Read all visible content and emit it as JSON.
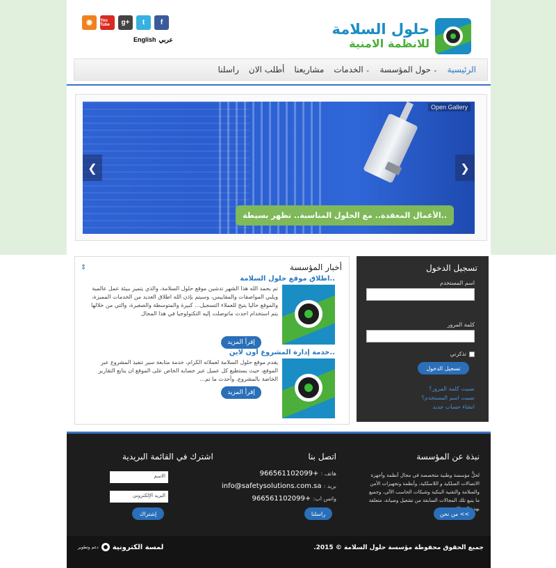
{
  "header": {
    "logo_line1": "حلول السلامة",
    "logo_line2": "للانظمة الامنية",
    "socials": [
      {
        "name": "rss-icon",
        "glyph": "◉"
      },
      {
        "name": "youtube-icon",
        "glyph": "You Tube"
      },
      {
        "name": "google-plus-icon",
        "glyph": "g+"
      },
      {
        "name": "twitter-icon",
        "glyph": "t"
      },
      {
        "name": "facebook-icon",
        "glyph": "f"
      }
    ],
    "lang_arabic": "عربي",
    "lang_english": "English"
  },
  "nav": {
    "items": [
      {
        "label": "الرئيسية",
        "active": true,
        "dropdown": false
      },
      {
        "label": "حول المؤسسة",
        "active": false,
        "dropdown": true
      },
      {
        "label": "الخدمات",
        "active": false,
        "dropdown": true
      },
      {
        "label": "مشاريعنا",
        "active": false,
        "dropdown": false
      },
      {
        "label": "أطلب الان",
        "active": false,
        "dropdown": false
      },
      {
        "label": "راسلنا",
        "active": false,
        "dropdown": false
      }
    ],
    "chevron": "⌄"
  },
  "slider": {
    "open_gallery": "Open Gallery",
    "caption": "الأعمال المعقدة.. مع الحلول المناسبة.. تظهر بسيطة..",
    "prev": "❮",
    "next": "❯"
  },
  "news": {
    "title": "أخبار المؤسسة",
    "scroll_glyph": "⇕",
    "items": [
      {
        "title": "اطلاق موقع حلول السلامة..",
        "body": "تم بحمد الله هذا الشهر تدشين موقع حلول السلامة، والذي يتميز ببيئة عمل عالمية ويلبي المواصفات والمقاييس، وسيتم بإذن الله اطلاق العديد من الخدمات المميزة، والموقع حاليا يتيح للعملاء التسجيل... كبيرة والمتوسطة والصغيرة، والتي من خلالها يتم استخدام احدث ماتوصلت إليه التكنولوجيا في هذا المجال",
        "more": "إقرأ المزيد"
      },
      {
        "title": "خدمة إدارة المشروع أون لاين..",
        "body": "يقدم موقع حلول السلامة لعملائه الكرام، خدمة متابعة سير تنفيذ المشروع عبر الموقع، حيث يستطيع كل عميل عبر حسابه الخاص على الموقع ان يتابع التقارير الخاصة بالمشروع، وأحدث ما تم...",
        "more": "إقرأ المزيد"
      }
    ]
  },
  "login": {
    "title": "تسجيل الدخول",
    "username_label": "اسم المستخدم",
    "password_label": "كلمة المرور",
    "remember_label": "تذكرني",
    "submit": "تسجيل الدخول",
    "links": [
      "نسيت كلمة المرور؟",
      "نسيت اسم المستخدم؟",
      "انشاء حساب جديد"
    ]
  },
  "footer": {
    "about_title": "نبذة عن المؤسسة",
    "about_text": "لحلُّ مؤسسة وطنية متخصصة في مجال أنظمة وأجهزة الاتصالات السلكية و اللاسلكية، وأنظمة وتجهيزات الأمن والسلامة والتقنية البنكية وشبكات الحاسب الآلي، وجميع ما يتبع تلك المجالات السابقة من تشغيل وصيانة، متعلقة بهذه المجالات",
    "about_button": "من نحن <<",
    "contact_title": "اتصل بنا",
    "phone_label": "هاتف :",
    "phone": "+966561102099",
    "email_label": "بريد :",
    "email": "info@safetysolutions.com.sa",
    "whatsapp_label": "واتس اب:",
    "whatsapp": "+966561102099",
    "contact_button": "راسلنا",
    "newsletter_title": "اشترك في القائمة البريدية",
    "name_placeholder": "الاسم",
    "email_placeholder": "البريد الإلكتروني",
    "subscribe_button": "إشتراك",
    "copyright": "جميع الحقوق محفوظة مؤسسة حلول السلامة © 2015.",
    "credit_small": "دعم وتطوير",
    "credit_big": "لمسة الكترونية"
  }
}
